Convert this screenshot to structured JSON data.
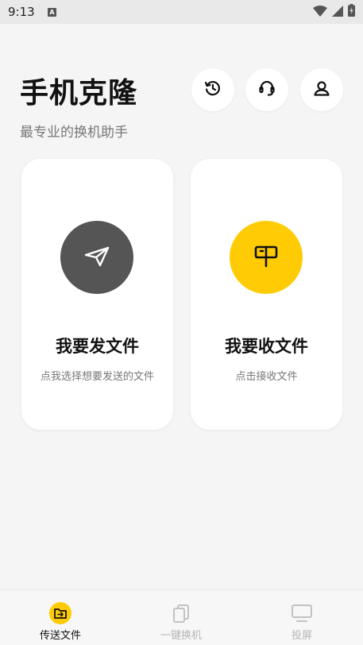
{
  "status_bar": {
    "time": "9:13",
    "badge": "A",
    "icons": [
      "wifi-icon",
      "signal-icon",
      "battery-charging-icon"
    ]
  },
  "header": {
    "title": "手机克隆",
    "subtitle": "最专业的换机助手",
    "buttons": [
      {
        "icon": "history-icon"
      },
      {
        "icon": "headset-icon"
      },
      {
        "icon": "profile-icon"
      }
    ]
  },
  "cards": {
    "send": {
      "title": "我要发文件",
      "description": "点我选择想要发送的文件",
      "icon": "paper-plane-icon",
      "color": "#555555"
    },
    "receive": {
      "title": "我要收文件",
      "description": "点击接收文件",
      "icon": "mailbox-icon",
      "color": "#ffcb05"
    }
  },
  "bottom_nav": {
    "items": [
      {
        "label": "传送文件",
        "icon": "folder-transfer-icon",
        "active": true
      },
      {
        "label": "一键换机",
        "icon": "phone-switch-icon",
        "active": false
      },
      {
        "label": "投屏",
        "icon": "monitor-icon",
        "active": false
      }
    ]
  },
  "colors": {
    "accent": "#ffcb05",
    "dark_circle": "#555555",
    "background": "#f5f5f5",
    "inactive_text": "#b5b5b5"
  }
}
